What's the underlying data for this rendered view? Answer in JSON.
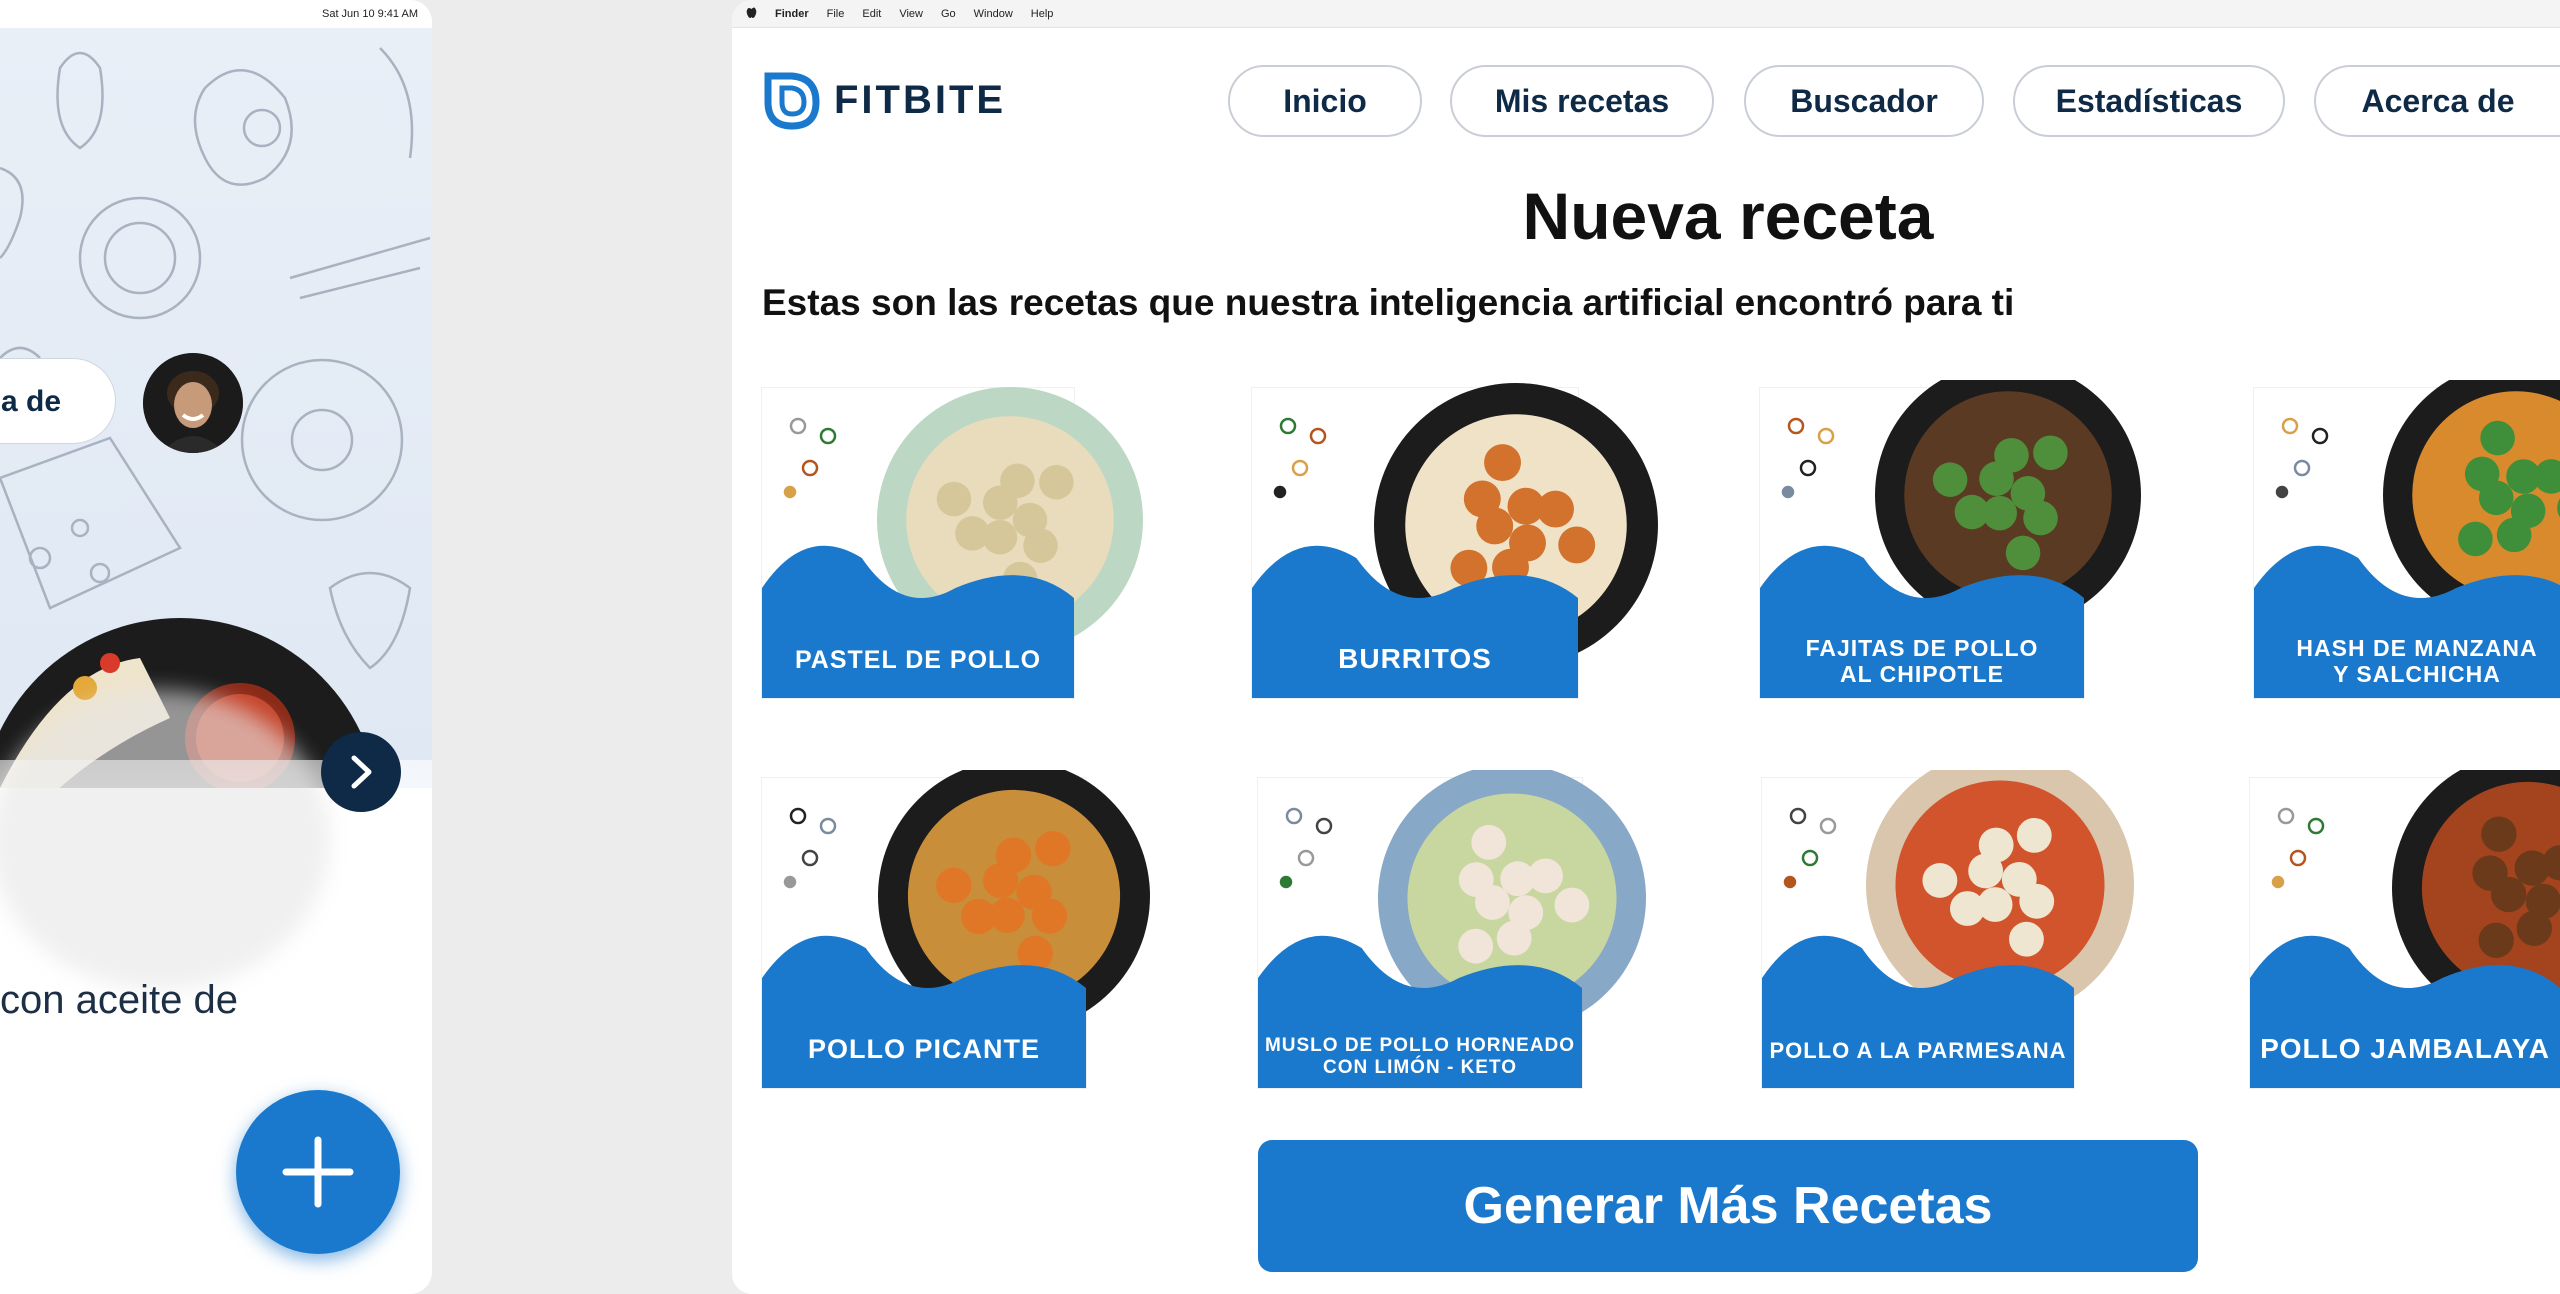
{
  "tablet": {
    "status_time": "Sat Jun 10  9:41 AM",
    "pill_partial_label": "a de",
    "body_text_partial": "con aceite de"
  },
  "mac": {
    "menubar": [
      "Finder",
      "File",
      "Edit",
      "View",
      "Go",
      "Window",
      "Help"
    ],
    "logo_text": "FITBITE",
    "nav": [
      "Inicio",
      "Mis recetas",
      "Buscador",
      "Estadísticas",
      "Acerca de"
    ],
    "title": "Nueva receta",
    "subtitle": "Estas son las recetas que nuestra inteligencia artificial encontró para ti",
    "recipes": [
      {
        "line1": "PASTEL DE POLLO",
        "line2": ""
      },
      {
        "line1": "BURRITOS",
        "line2": ""
      },
      {
        "line1": "FAJITAS DE POLLO",
        "line2": "AL CHIPOTLE"
      },
      {
        "line1": "HASH DE MANZANA",
        "line2": "Y SALCHICHA"
      },
      {
        "line1": "POLLO PICANTE",
        "line2": ""
      },
      {
        "line1": "MUSLO DE POLLO HORNEADO",
        "line2": "CON LIMÓN - KETO"
      },
      {
        "line1": "POLLO A LA PARMESANA",
        "line2": ""
      },
      {
        "line1": "POLLO JAMBALAYA",
        "line2": ""
      }
    ],
    "generate_button": "Generar Más Recetas"
  },
  "colors": {
    "brand_blue": "#1a79cc",
    "navy": "#0e2a47",
    "hero_bg": "#e4ecf6"
  },
  "icons": [
    "apple-icon",
    "fitbite-logo-icon",
    "chevron-right-icon",
    "plus-icon"
  ]
}
